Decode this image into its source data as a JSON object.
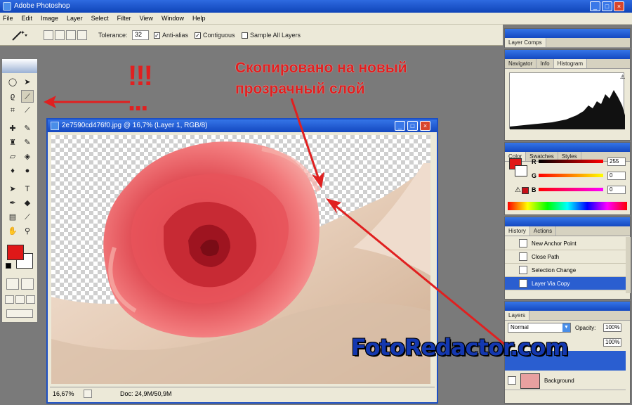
{
  "app": {
    "title": "Adobe Photoshop",
    "window_buttons": {
      "minimize": "_",
      "maximize": "□",
      "close": "×"
    }
  },
  "menu": [
    "File",
    "Edit",
    "Image",
    "Layer",
    "Select",
    "Filter",
    "View",
    "Window",
    "Help"
  ],
  "options_bar": {
    "tolerance_label": "Tolerance:",
    "tolerance_value": "32",
    "anti_alias": "Anti-alias",
    "contiguous": "Contiguous",
    "sample_all": "Sample All Layers",
    "check_mark": "✓"
  },
  "document": {
    "title": "2e7590cd476f0.jpg @ 16,7% (Layer 1, RGB/8)",
    "zoom": "16,67%",
    "doc_info": "Doc: 24,9M/50,9M"
  },
  "annotation": {
    "line1": "Скопировано на новый",
    "line2": "прозрачный слой",
    "marks": "!!!\n..."
  },
  "panels": {
    "layer_comps": {
      "tab": "Layer Comps"
    },
    "navigator": {
      "tabs": [
        "Navigator",
        "Info",
        "Histogram"
      ]
    },
    "color": {
      "tabs": [
        "Color",
        "Swatches",
        "Styles"
      ],
      "r_label": "R",
      "g_label": "G",
      "b_label": "B",
      "r_value": "255",
      "g_value": "0",
      "b_value": "0",
      "fg_color": "#e01818"
    },
    "history": {
      "tabs": [
        "History",
        "Actions"
      ],
      "items": [
        "New Anchor Point",
        "Close Path",
        "Selection Change",
        "Layer Via Copy"
      ]
    },
    "layers": {
      "tab": "Layers",
      "blend_mode": "Normal",
      "opacity_label": "Opacity:",
      "opacity_value": "100%",
      "fill_value": "100%",
      "background_layer": "Background"
    }
  },
  "watermark": "FotoRedactor.com",
  "colors": {
    "accent": "#1c4fc4",
    "annotation_red": "#e02020",
    "foreground": "#e01818",
    "background": "#ffffff"
  }
}
